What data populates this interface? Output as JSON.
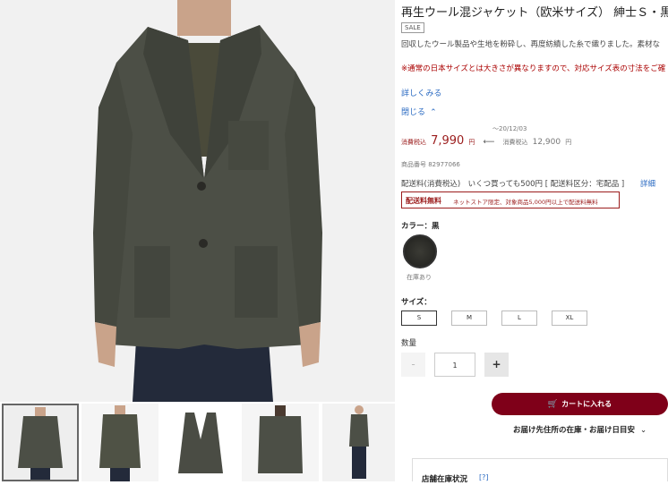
{
  "product": {
    "title": "再生ウール混ジャケット（欧米サイズ） 紳士Ｓ・黒",
    "sale_badge": "SALE",
    "description": "回収したウール製品や生地を粉砕し、再度紡績した糸で織りました。素材な",
    "note": "※通常の日本サイズとは大きさが異なりますので、対応サイズ表の寸法をご確",
    "more_link": "詳しくみる",
    "close_link": "閉じる",
    "price": {
      "tax_label": "消費税込",
      "current": "7,990",
      "unit": "円",
      "arrow": "⟵",
      "until": "～20/12/03",
      "orig_tax_label": "消費税込",
      "original": "12,900",
      "orig_unit": "円"
    },
    "item_number": "商品番号 82977066",
    "shipping": "配送料(消費税込)　いくつ買っても500円 [ 配送料区分：宅配品 ]",
    "shipping_link": "詳細",
    "free_shipping_label": "配送料無料",
    "free_shipping_note": "ネットストア限定、対象商品5,000円以上で配送料無料",
    "color_label": "カラー：黒",
    "color_stock": "在庫あり",
    "size_label": "サイズ：",
    "sizes": [
      "S",
      "M",
      "L",
      "XL"
    ],
    "selected_size": "S",
    "qty_label": "数量",
    "qty_minus": "-",
    "qty_value": "1",
    "qty_plus": "+",
    "cart_button": "カートに入れる",
    "stock_link": "お届け先住所の在庫・お届け日目安",
    "store_stock": "店舗在庫状況",
    "store_help": "[?]"
  },
  "colors": {
    "accent": "#7f0019",
    "price_red": "#9b1c1c",
    "link_blue": "#2a6ac2"
  }
}
